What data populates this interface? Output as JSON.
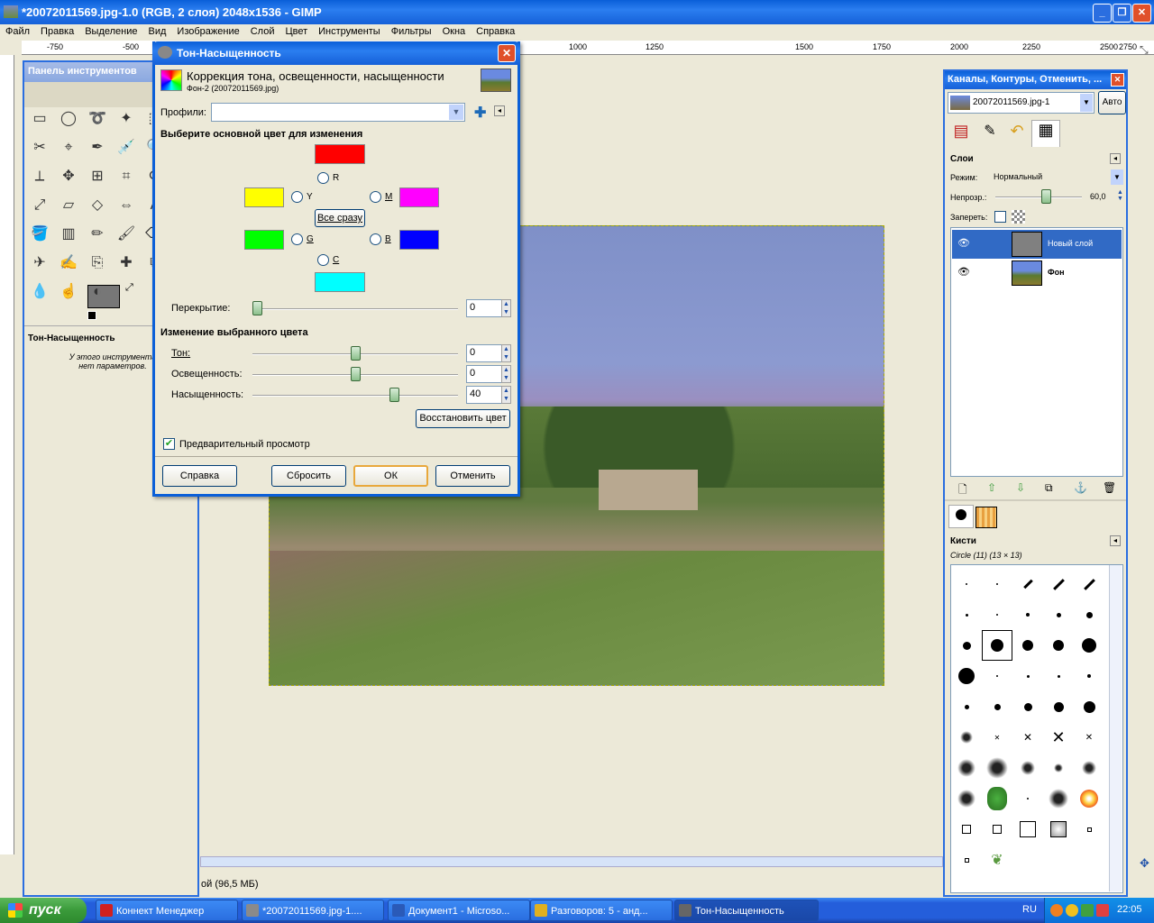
{
  "window": {
    "title": "*20072011569.jpg-1.0 (RGB, 2 слоя) 2048x1536 - GIMP"
  },
  "menu": [
    "Файл",
    "Правка",
    "Выделение",
    "Вид",
    "Изображение",
    "Слой",
    "Цвет",
    "Инструменты",
    "Фильтры",
    "Окна",
    "Справка"
  ],
  "ruler": [
    "-750",
    "-500",
    "1000",
    "1250",
    "1500",
    "1750",
    "2000",
    "2250",
    "2500",
    "2750"
  ],
  "toolbox": {
    "title": "Панель инструментов",
    "tool_name": "Тон-Насыщенность",
    "note": "У этого инструмента нет параметров."
  },
  "status": {
    "size": "ой (96,5 МБ)"
  },
  "dialog": {
    "title": "Тон-Насыщенность",
    "header": "Коррекция тона, освещенности, насыщенности",
    "subheader": "Фон-2 (20072011569.jpg)",
    "profiles_label": "Профили:",
    "profiles_value": "",
    "select_label": "Выберите основной цвет для изменения",
    "colors": {
      "R": "R",
      "Y": "Y",
      "M": "M",
      "G": "G",
      "B": "B",
      "C": "C"
    },
    "all_button": "Все сразу",
    "overlap_label": "Перекрытие:",
    "overlap_value": "0",
    "overlap_level": 0,
    "modify_label": "Изменение выбранного цвета",
    "hue_label": "Тон:",
    "hue_value": "0",
    "hue_level": 0,
    "lightness_label": "Освещенность:",
    "lightness_value": "0",
    "lightness_level": 0,
    "saturation_label": "Насыщенность:",
    "saturation_value": "40",
    "saturation_level": 40,
    "reset_color_button": "Восстановить цвет",
    "preview_label": "Предварительный просмотр",
    "preview_checked": true,
    "buttons": {
      "help": "Справка",
      "reset": "Сбросить",
      "ok": "ОК",
      "cancel": "Отменить"
    }
  },
  "right_panel": {
    "title": "Каналы, Контуры, Отменить, ...",
    "image_name": "20072011569.jpg-1",
    "auto_button": "Авто",
    "layers_title": "Слои",
    "mode_label": "Режим:",
    "mode_value": "Нормальный",
    "opacity_label": "Непрозр.:",
    "opacity_value": "60,0",
    "opacity_level": 60,
    "lock_label": "Запереть:",
    "layers": [
      {
        "name": "Новый слой",
        "selected": true
      },
      {
        "name": "Фон",
        "selected": false
      }
    ],
    "brushes_title": "Кисти",
    "brush_name": "Circle (11) (13 × 13)"
  },
  "taskbar": {
    "start": "пуск",
    "tasks": [
      "Коннект Менеджер",
      "*20072011569.jpg-1....",
      "Документ1 - Microso...",
      "Разговоров: 5 - анд...",
      "Тон-Насыщенность"
    ],
    "lang": "RU",
    "time": "22:05"
  },
  "colors": {
    "red": "#ff0000",
    "yellow": "#ffff00",
    "magenta": "#ff00ff",
    "green": "#00ff00",
    "blue": "#0000ff",
    "cyan": "#00ffff",
    "titlebar": "#0a5fd8"
  }
}
